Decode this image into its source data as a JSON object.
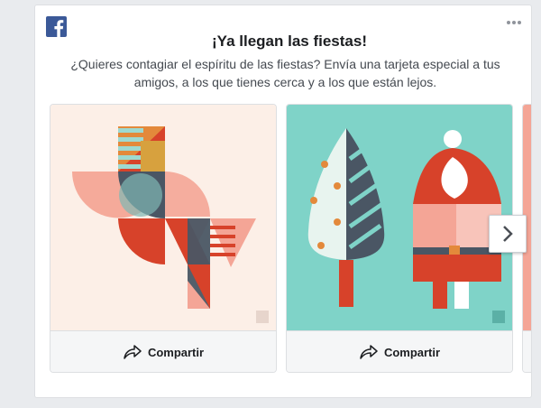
{
  "card": {
    "title": "¡Ya llegan las fiestas!",
    "subtitle": "¿Quieres contagiar el espíritu de las fiestas? Envía una tarjeta especial a tus amigos, a los que tienes cerca y a los que están lejos."
  },
  "slides": [
    {
      "share_label": "Compartir"
    },
    {
      "share_label": "Compartir"
    }
  ],
  "colors": {
    "facebook_blue": "#3b5998",
    "slide1_bg": "#fcefe7",
    "slide2_bg": "#7fd3c8"
  },
  "icons": {
    "logo": "facebook-logo-icon",
    "more": "more-options-icon",
    "share": "share-arrow-icon",
    "next": "chevron-right-icon"
  }
}
